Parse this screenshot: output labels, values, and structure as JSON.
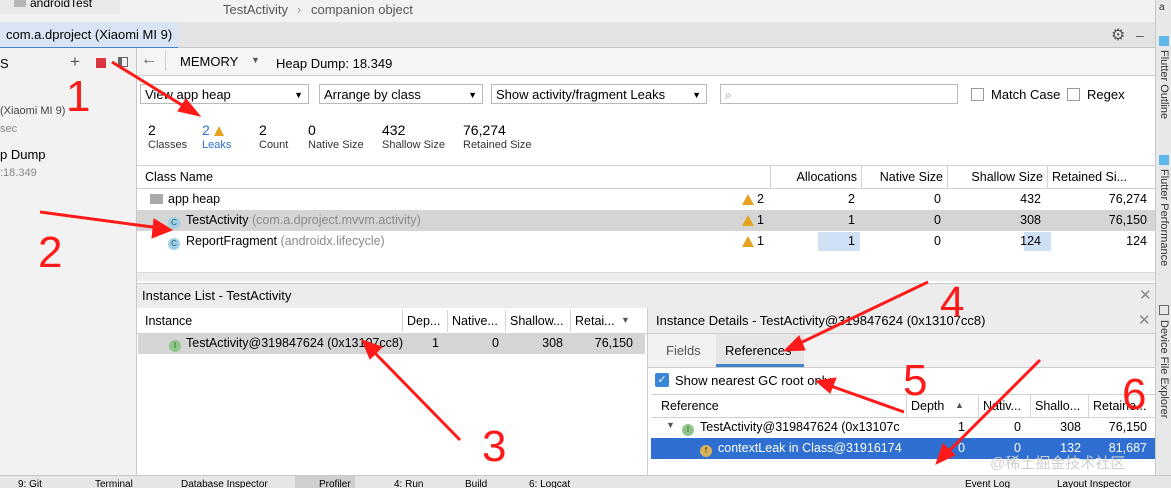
{
  "editor": {
    "breadcrumb": [
      "TestActivity",
      "companion object"
    ],
    "tree_item": "androidTest"
  },
  "device_tab": "com.a.dproject (Xiaomi MI 9)",
  "left": {
    "session_partial": "(Xiaomi MI 9)",
    "session_sub": "sec",
    "heap_item": "p Dump",
    "heap_time": ":18.349",
    "s_label": "S"
  },
  "toolbar": {
    "memory": "MEMORY",
    "heap_dump": "Heap Dump: 18.349"
  },
  "filters": {
    "heap": "View app heap",
    "arrange": "Arrange by class",
    "leaks": "Show activity/fragment Leaks",
    "match_case": "Match Case",
    "regex": "Regex"
  },
  "stats": [
    {
      "value": "2",
      "label": "Classes"
    },
    {
      "value": "2",
      "label": "Leaks"
    },
    {
      "value": "2",
      "label": "Count"
    },
    {
      "value": "0",
      "label": "Native Size"
    },
    {
      "value": "432",
      "label": "Shallow Size"
    },
    {
      "value": "76,274",
      "label": "Retained Size"
    }
  ],
  "class_table": {
    "headers": [
      "Class Name",
      "Allocations",
      "Native Size",
      "Shallow Size",
      "Retained Si..."
    ],
    "rows": [
      {
        "name": "app heap",
        "pkg": "",
        "warn": "2",
        "alloc": "2",
        "native": "0",
        "shallow": "432",
        "retained": "76,274"
      },
      {
        "name": "TestActivity",
        "pkg": "(com.a.dproject.mvvm.activity)",
        "warn": "1",
        "alloc": "1",
        "native": "0",
        "shallow": "308",
        "retained": "76,150"
      },
      {
        "name": "ReportFragment",
        "pkg": "(androidx.lifecycle)",
        "warn": "1",
        "alloc": "1",
        "native": "0",
        "shallow": "124",
        "retained": "124"
      }
    ]
  },
  "instance_list": {
    "title": "Instance List - TestActivity",
    "headers": [
      "Instance",
      "Dep...",
      "Native...",
      "Shallow...",
      "Retai..."
    ],
    "row": {
      "name": "TestActivity@319847624 (0x13107cc8)",
      "depth": "1",
      "native": "0",
      "shallow": "308",
      "retained": "76,150"
    }
  },
  "details": {
    "title": "Instance Details - TestActivity@319847624 (0x13107cc8)",
    "tabs": [
      "Fields",
      "References"
    ],
    "gc_label": "Show nearest GC root only",
    "headers": [
      "Reference",
      "Depth",
      "Nativ...",
      "Shallo...",
      "Retaine..."
    ],
    "rows": [
      {
        "name": "TestActivity@319847624 (0x13107c",
        "depth": "1",
        "native": "0",
        "shallow": "308",
        "retained": "76,150"
      },
      {
        "name": "contextLeak in Class@31916174",
        "depth": "0",
        "native": "0",
        "shallow": "132",
        "retained": "81,687"
      }
    ]
  },
  "right_tools": [
    "Flutter Outline",
    "Flutter Performance",
    "Device File Explorer"
  ],
  "bottom_tabs": [
    "9: Git",
    "Terminal",
    "Database Inspector",
    "Profiler",
    "4: Run",
    "Build",
    "6: Logcat",
    "Event Log",
    "Layout Inspector"
  ],
  "annotations": [
    "1",
    "2",
    "3",
    "4",
    "5",
    "6"
  ],
  "watermark": "@稀土掘金技术社区"
}
